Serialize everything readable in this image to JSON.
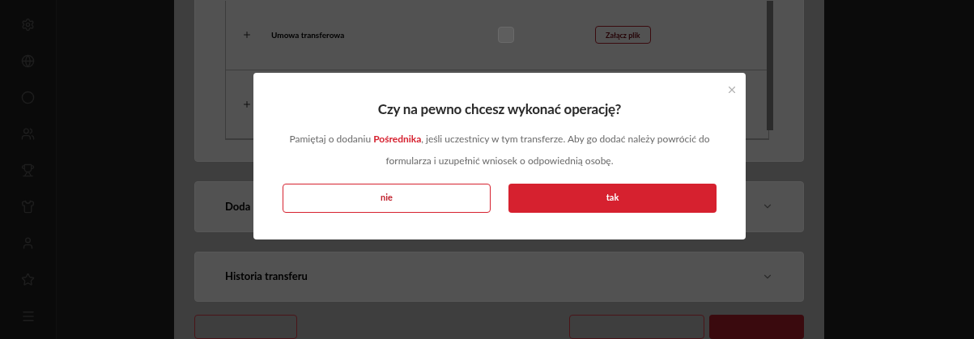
{
  "documents": {
    "rows": [
      {
        "label": "Umowa transferowa",
        "expanded": false,
        "checked": false,
        "attach_button": "Załącz plik"
      },
      {
        "expanded": false
      }
    ]
  },
  "sections": [
    {
      "title": "Doda",
      "expanded": false
    },
    {
      "title": "Historia transferu",
      "expanded": false
    }
  ],
  "dialog": {
    "title": "Czy na pewno chcesz wykonać operację?",
    "message": "Pamiętaj o dodaniu **Pośrednika**, jeśli uczestnicy w tym transferze. Aby go dodać należy powrócić do formularza i uzupełnić wniosek o odpowiednią osobę.",
    "cancel_button": "nie",
    "confirm_button": "tak"
  }
}
